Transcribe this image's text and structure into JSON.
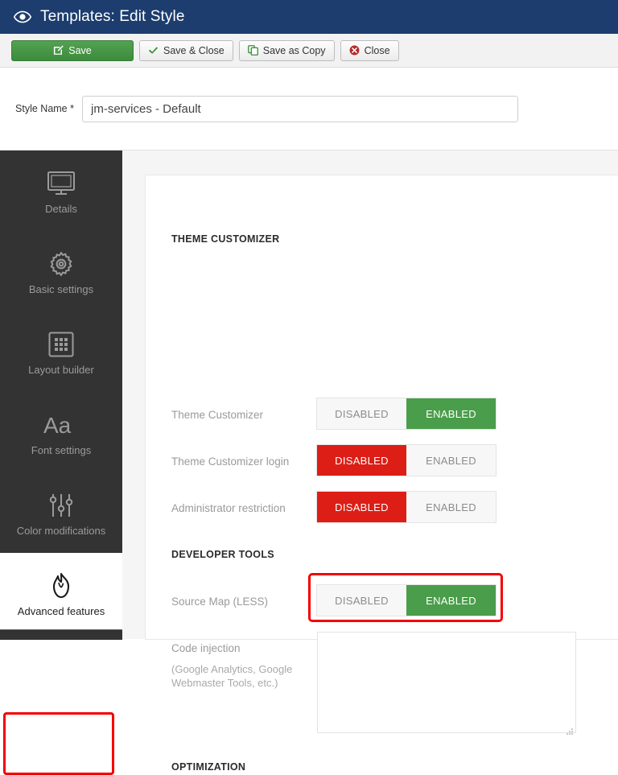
{
  "header": {
    "icon": "eye-icon",
    "title": "Templates: Edit Style"
  },
  "toolbar": {
    "buttons": [
      {
        "label": "Save",
        "icon": "edit-pencil-icon",
        "style": "primary"
      },
      {
        "label": "Save & Close",
        "icon": "check-icon",
        "style": "default"
      },
      {
        "label": "Save as Copy",
        "icon": "copy-icon",
        "style": "default"
      },
      {
        "label": "Close",
        "icon": "close-circle-icon",
        "style": "default"
      }
    ]
  },
  "style_name_field": {
    "label": "Style Name",
    "required_marker": "*",
    "value": "jm-services - Default",
    "placeholder": ""
  },
  "sidebar": {
    "items": [
      {
        "label": "Details",
        "icon": "monitor-icon",
        "active": false
      },
      {
        "label": "Basic settings",
        "icon": "gear-icon",
        "active": false
      },
      {
        "label": "Layout builder",
        "icon": "grid-icon",
        "active": false
      },
      {
        "label": "Font settings",
        "icon": "aa-typography-icon",
        "active": false
      },
      {
        "label": "Color modifications",
        "icon": "sliders-icon",
        "active": false
      },
      {
        "label": "Advanced features",
        "icon": "flame-icon",
        "active": true
      }
    ]
  },
  "main": {
    "sections": [
      {
        "title": "THEME CUSTOMIZER",
        "rows": [
          {
            "label": "Theme Customizer",
            "type": "toggle",
            "options": [
              "DISABLED",
              "ENABLED"
            ],
            "selected": "ENABLED",
            "selected_color": "#4a9d4a"
          },
          {
            "label": "Theme Customizer login",
            "type": "toggle",
            "options": [
              "DISABLED",
              "ENABLED"
            ],
            "selected": "DISABLED",
            "selected_color": "#dc1e16"
          },
          {
            "label": "Administrator restriction",
            "type": "toggle",
            "options": [
              "DISABLED",
              "ENABLED"
            ],
            "selected": "DISABLED",
            "selected_color": "#dc1e16"
          }
        ]
      },
      {
        "title": "DEVELOPER TOOLS",
        "rows": [
          {
            "label": "Source Map (LESS)",
            "type": "toggle",
            "options": [
              "DISABLED",
              "ENABLED"
            ],
            "selected": "ENABLED",
            "selected_color": "#4a9d4a",
            "highlighted": true
          },
          {
            "label": "Code injection",
            "sublabel": "(Google Analytics, Google Webmaster Tools, etc.)",
            "type": "textarea",
            "value": "",
            "placeholder": ""
          }
        ]
      },
      {
        "title": "OPTIMIZATION",
        "rows": []
      }
    ]
  },
  "annotations": {
    "highlight_color": "#f50000",
    "highlighted_elements": [
      "Source Map (LESS) toggle",
      "Advanced features sidebar item"
    ]
  }
}
